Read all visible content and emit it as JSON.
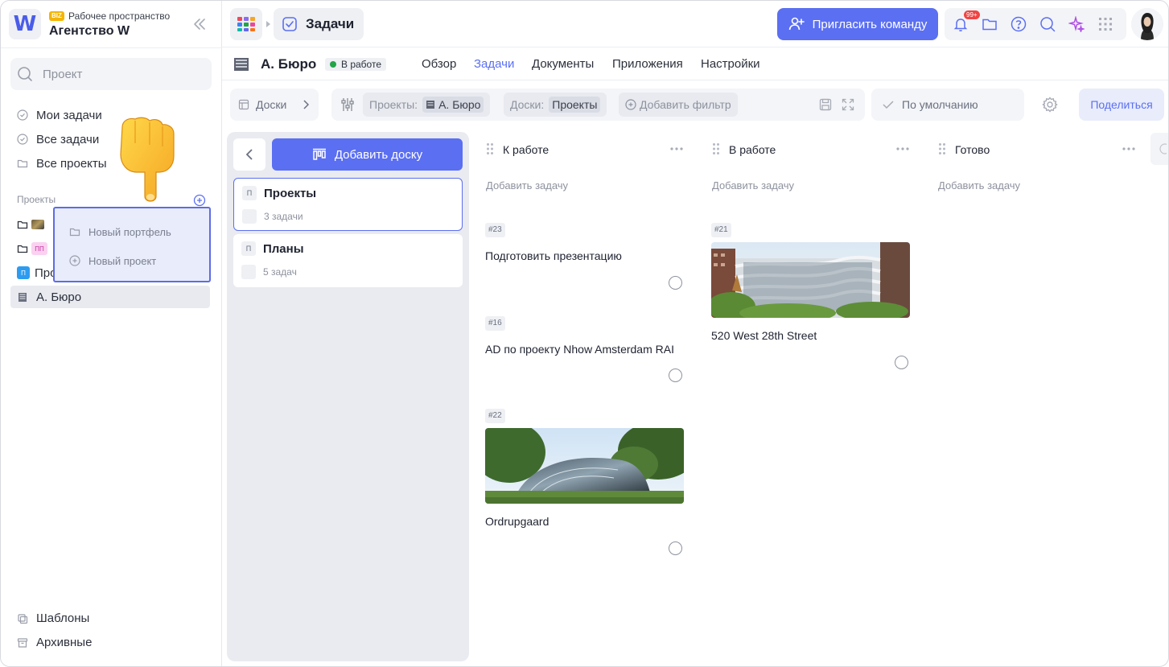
{
  "workspace": {
    "badge": "BIZ",
    "subtitle": "Рабочее пространство",
    "name": "Агентство W",
    "logo_letter": "W"
  },
  "sidebar": {
    "search_placeholder": "Проект",
    "nav": [
      {
        "label": "Мои задачи",
        "icon": "check-circle-icon"
      },
      {
        "label": "Все задачи",
        "icon": "check-circle-icon"
      },
      {
        "label": "Все проекты",
        "icon": "folder-icon"
      }
    ],
    "projects_label": "Проекты",
    "projects": [
      {
        "label": "",
        "icon": "folder-icon"
      },
      {
        "label": "",
        "icon": "folder-icon",
        "badge": "ПП"
      },
      {
        "label": "Про",
        "icon": "project-badge-icon",
        "badge": "П"
      },
      {
        "label": "А. Бюро",
        "icon": "building-icon",
        "active": true
      }
    ],
    "popup": {
      "items": [
        {
          "label": "Новый портфель",
          "icon": "folder-icon"
        },
        {
          "label": "Новый проект",
          "icon": "plus-circle-icon"
        }
      ]
    },
    "bottom": [
      {
        "label": "Шаблоны",
        "icon": "templates-icon"
      },
      {
        "label": "Архивные",
        "icon": "archive-icon"
      }
    ]
  },
  "topbar": {
    "section_title": "Задачи",
    "invite_label": "Пригласить команду",
    "notif_count": "99+"
  },
  "project": {
    "title": "А. Бюро",
    "status": "В работе",
    "status_color": "#22a447",
    "tabs": [
      {
        "label": "Обзор",
        "active": false
      },
      {
        "label": "Задачи",
        "active": true
      },
      {
        "label": "Документы",
        "active": false
      },
      {
        "label": "Приложения",
        "active": false
      },
      {
        "label": "Настройки",
        "active": false
      }
    ]
  },
  "filters": {
    "boards_label": "Доски",
    "projects_key": "Проекты:",
    "projects_value": "А. Бюро",
    "boards_key": "Доски:",
    "boards_value": "Проекты",
    "add_filter": "Добавить фильтр",
    "view_label": "По умолчанию",
    "share_label": "Поделиться"
  },
  "boards_panel": {
    "add_board": "Добавить доску",
    "boards": [
      {
        "letter": "П",
        "title": "Проекты",
        "count": "3 задачи",
        "selected": true
      },
      {
        "letter": "П",
        "title": "Планы",
        "count": "5 задач",
        "selected": false
      }
    ]
  },
  "columns": [
    {
      "title": "К работе",
      "add_task": "Добавить задачу",
      "tasks": [
        {
          "num": "#23",
          "title": "Подготовить презентацию",
          "has_image": false
        },
        {
          "num": "#16",
          "title": "AD по проекту Nhow Amsterdam RAI",
          "has_image": false
        },
        {
          "num": "#22",
          "title": "Ordrupgaard",
          "has_image": true
        }
      ]
    },
    {
      "title": "В работе",
      "add_task": "Добавить задачу",
      "tasks": [
        {
          "num": "#21",
          "title": "520 West 28th Street",
          "has_image": true
        }
      ]
    },
    {
      "title": "Готово",
      "add_task": "Добавить задачу",
      "tasks": []
    }
  ],
  "colors": {
    "accent": "#5b6ff2",
    "accent_light": "#e8ecfb",
    "sidebar_active": "#e8eaf0"
  }
}
